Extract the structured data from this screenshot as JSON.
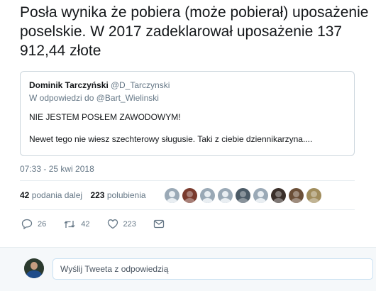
{
  "tweet": {
    "text": "Posła wynika że pobiera (może pobierał) uposażenie poselskie. W 2017 zadeklarował uposażenie 137 912,44 złote"
  },
  "quoted": {
    "name": "Dominik Tarczyński",
    "handle": "@D_Tarczynski",
    "reply_to": "W odpowiedzi do @Bart_Wielinski",
    "line1": "NIE JESTEM POSŁEM ZAWODOWYM!",
    "line2": "Newet tego nie wiesz szechterowy sługusie. Taki z ciebie dziennikarzyna...."
  },
  "timestamp": "07:33 - 25 kwi 2018",
  "stats": {
    "retweets_count": "42",
    "retweets_label": "podania dalej",
    "likes_count": "223",
    "likes_label": "polubienia",
    "liker_avatars": [
      "avatar",
      "avatar",
      "avatar",
      "avatar",
      "avatar",
      "avatar",
      "avatar",
      "avatar",
      "avatar",
      "avatar"
    ]
  },
  "actions": {
    "reply_count": "26",
    "retweet_count": "42",
    "like_count": "223"
  },
  "reply": {
    "placeholder": "Wyślij Tweeta z odpowiedzią"
  },
  "colors": {
    "text": "#14171a",
    "muted": "#657786",
    "border": "#e6ecf0",
    "input_border": "#c8e0f2"
  }
}
